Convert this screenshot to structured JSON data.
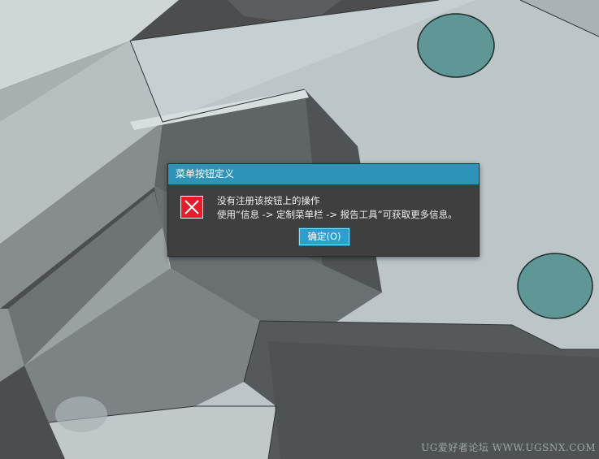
{
  "dialog": {
    "title": "菜单按钮定义",
    "icon": "error-x-icon",
    "message_line1": "没有注册该按钮上的操作",
    "message_line2": "使用“信息 -> 定制菜单栏 -> 报告工具”可获取更多信息。",
    "ok_label": "确定(O)"
  },
  "watermark": "UG爱好者论坛 WWW.UGSNX.COM",
  "colors": {
    "title_bar": "#2e93b9",
    "dialog_bg": "#3f3f3f",
    "error_red": "#e01f2b",
    "ok_button": "#2a9fd0",
    "hole_fill": "#5e9796"
  }
}
